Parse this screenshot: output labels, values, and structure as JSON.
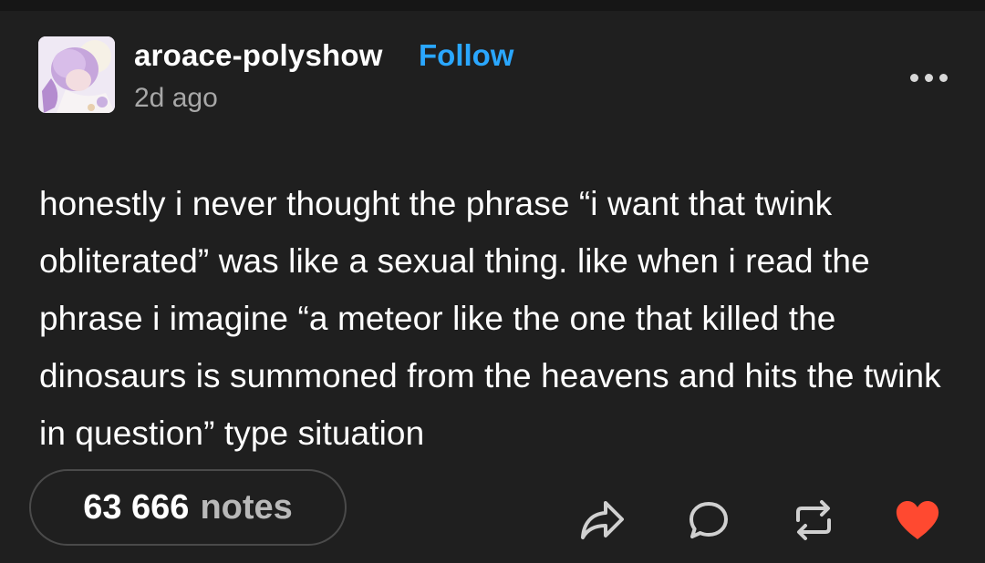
{
  "post": {
    "username": "aroace-polyshow",
    "follow_label": "Follow",
    "timestamp": "2d ago",
    "text": "honestly i never thought the phrase “i want that twink obliterated” was like a sexual thing. like when i read the phrase i imagine “a meteor like the one that killed the dinosaurs is summoned from the heavens and hits the twink in question” type situation",
    "notes_count": "63 666",
    "notes_label": "notes"
  },
  "icons": {
    "more": "more-options-icon",
    "share": "share-icon",
    "reply": "reply-icon",
    "reblog": "reblog-icon",
    "like": "heart-icon"
  },
  "colors": {
    "background": "#1f1f1f",
    "follow": "#2aa7ff",
    "like": "#ff4930",
    "muted_text": "#a8a8a8"
  }
}
